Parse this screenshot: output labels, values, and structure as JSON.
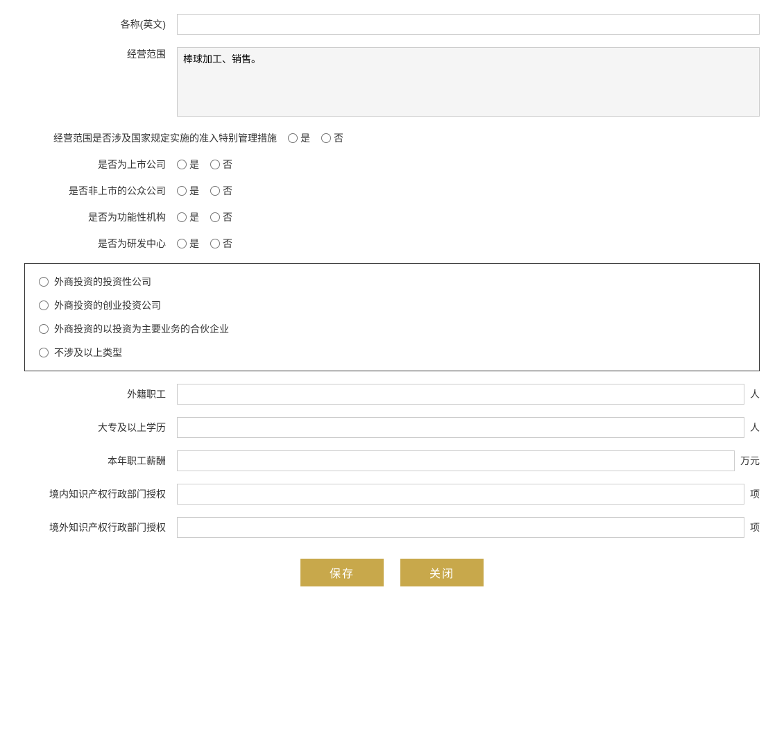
{
  "fields": {
    "english_name_label": "各称(英文)",
    "business_scope_label": "经营范围",
    "business_scope_value": "棒球加工、销售。",
    "special_mgmt_label": "经营范围是否涉及国家规定实施的准入特别管理措施",
    "listed_company_label": "是否为上市公司",
    "public_company_label": "是否非上市的公众公司",
    "functional_org_label": "是否为功能性机构",
    "rd_center_label": "是否为研发中心",
    "yes_label": "是",
    "no_label": "否",
    "foreign_investment_options": [
      "外商投资的投资性公司",
      "外商投资的创业投资公司",
      "外商投资的以投资为主要业务的合伙企业",
      "不涉及以上类型"
    ],
    "foreign_staff_label": "外籍职工",
    "foreign_staff_unit": "人",
    "college_edu_label": "大专及以上学历",
    "college_edu_unit": "人",
    "annual_salary_label": "本年职工薪酬",
    "annual_salary_unit": "万元",
    "domestic_ip_label": "境内知识产权行政部门授权",
    "domestic_ip_unit": "项",
    "foreign_ip_label": "境外知识产权行政部门授权",
    "foreign_ip_unit": "项",
    "save_btn": "保存",
    "close_btn": "关闭"
  }
}
